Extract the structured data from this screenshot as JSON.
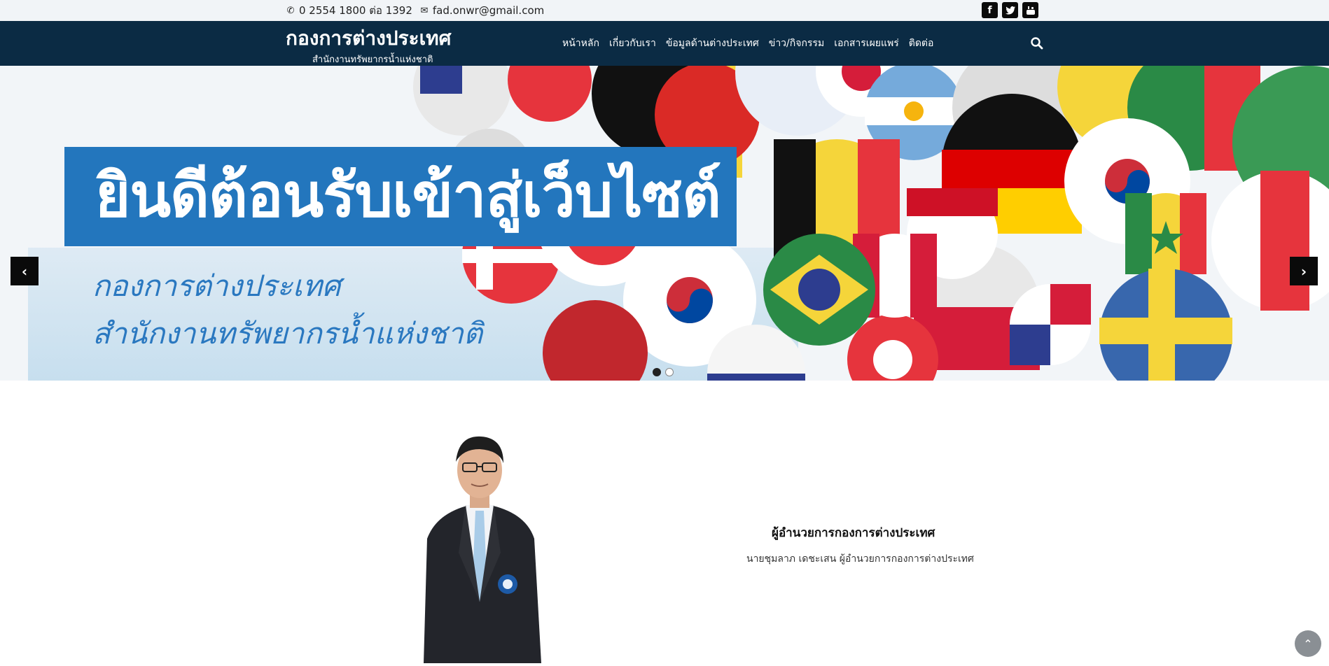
{
  "topbar": {
    "phone_icon": "phone-icon",
    "phone": "0 2554 1800 ต่อ 1392",
    "email_icon": "envelope-icon",
    "email": "fad.onwr@gmail.com",
    "social": [
      {
        "icon": "facebook-icon",
        "glyph": "f"
      },
      {
        "icon": "twitter-icon",
        "glyph": "t"
      },
      {
        "icon": "youtube-icon",
        "glyph": "▶"
      }
    ]
  },
  "header": {
    "title": "กองการต่างประเทศ",
    "subtitle": "สำนักงานทรัพยากรน้ำแห่งชาติ",
    "background": "#0b2b44",
    "menu": [
      {
        "label": "หน้าหลัก"
      },
      {
        "label": "เกี่ยวกับเรา"
      },
      {
        "label": "ข้อมูลด้านต่างประเทศ"
      },
      {
        "label": "ข่าว/กิจกรรม"
      },
      {
        "label": "เอกสารเผยแพร่"
      },
      {
        "label": "ติดต่อ"
      }
    ],
    "search_icon": "search-icon"
  },
  "hero": {
    "banner_text": "ยินดีต้อนรับเข้าสู่เว็บไซต์",
    "line1": "กองการต่างประเทศ",
    "line2": "สำนักงานทรัพยากรน้ำแห่งชาติ",
    "banner_color": "#2376bd",
    "prev_icon": "chevron-left-icon",
    "next_icon": "chevron-right-icon",
    "slides": 2,
    "active_slide": 1
  },
  "director": {
    "title": "ผู้อำนวยการกองการต่างประเทศ",
    "name": "นายชุมลาภ เดชะเสน ผู้อำนวยการกองการต่างประเทศ"
  },
  "back_to_top_icon": "chevron-up-icon"
}
